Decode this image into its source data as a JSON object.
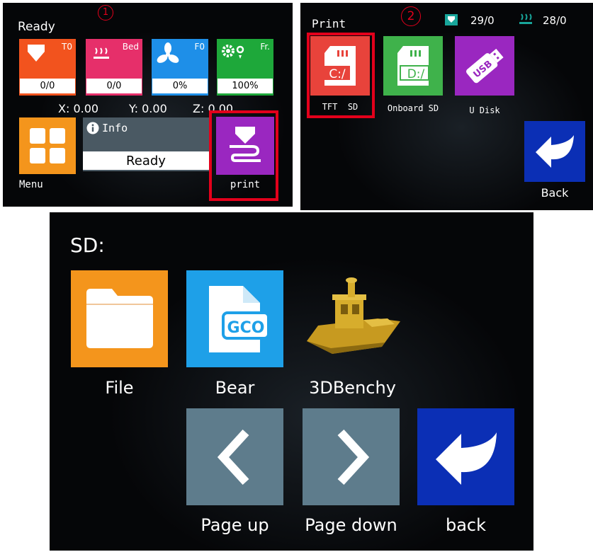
{
  "screen1": {
    "title": "Ready",
    "step_marker": "1",
    "tiles": [
      {
        "id": "t0",
        "label": "T0",
        "value": "0/0",
        "icon": "nozzle-icon",
        "color": "#f2531e"
      },
      {
        "id": "bed",
        "label": "Bed",
        "value": "0/0",
        "icon": "heat-bed-icon",
        "color": "#e62f6a"
      },
      {
        "id": "fan",
        "label": "F0",
        "value": "0%",
        "icon": "fan-icon",
        "color": "#1e8fe8"
      },
      {
        "id": "fr",
        "label": "Fr.",
        "value": "100%",
        "icon": "speed-gears-icon",
        "color": "#1ea83a"
      }
    ],
    "coords": {
      "x": "X: 0.00",
      "y": "Y: 0.00",
      "z": "Z: 0.00"
    },
    "menu_label": "Menu",
    "info_title": "Info",
    "info_status": "Ready",
    "print_label": "print"
  },
  "screen2": {
    "title": "Print",
    "step_marker": "2",
    "nozzle_temp": "29/0",
    "bed_temp": "28/0",
    "sources": [
      {
        "id": "tft-sd",
        "label": "TFT  SD",
        "card_text": "C:/",
        "color": "#e8433b"
      },
      {
        "id": "onboard-sd",
        "label": "Onboard SD",
        "card_text": "D:/",
        "color": "#3fb24b"
      },
      {
        "id": "u-disk",
        "label": "U Disk",
        "card_text": "USB",
        "color": "#9a27c0"
      }
    ],
    "back_label": "Back"
  },
  "screen3": {
    "title": "SD:",
    "items": [
      {
        "id": "file",
        "label": "File",
        "icon": "folder-icon",
        "color": "#f4951c"
      },
      {
        "id": "bear",
        "label": "Bear",
        "icon": "gcode-file-icon",
        "color": "#1ea0e8",
        "badge": "GCO"
      },
      {
        "id": "benchy",
        "label": "3DBenchy",
        "icon": "benchy-thumbnail"
      }
    ],
    "page_up_label": "Page up",
    "page_down_label": "Page down",
    "back_label": "back",
    "nav_color": "#5e7c8c",
    "back_color": "#0b2fb5"
  }
}
